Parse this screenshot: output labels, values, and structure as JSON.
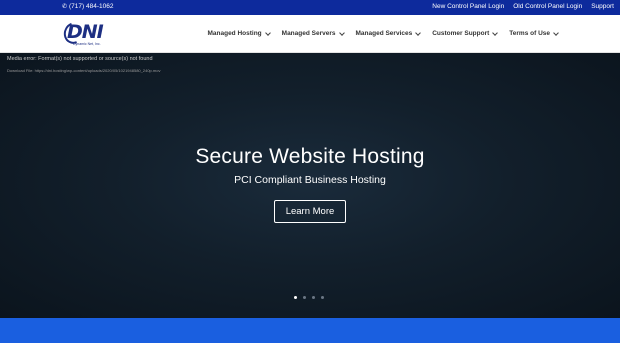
{
  "topbar": {
    "phone": "(717) 484-1062",
    "links": [
      "New Control Panel Login",
      "Old Control Panel Login",
      "Support"
    ]
  },
  "logo": {
    "text": "DNI",
    "subtext": "Dynamic Net, Inc."
  },
  "nav": {
    "items": [
      "Managed Hosting",
      "Managed Servers",
      "Managed Services",
      "Customer Support",
      "Terms of Use"
    ]
  },
  "hero": {
    "media_error": "Media error: Format(s) not supported or source(s) not found",
    "download_label": "Download File: https://dni.hosting/wp-content/uploads/2020/05/1021948580_240p.mov",
    "title": "Secure Website Hosting",
    "subtitle": "PCI Compliant Business Hosting",
    "button_label": "Learn More",
    "slide_count": 4,
    "active_slide": 1
  },
  "colors": {
    "topbar": "#0d2a9c",
    "accent_band": "#1a5fe0",
    "logo": "#1d2f83"
  }
}
